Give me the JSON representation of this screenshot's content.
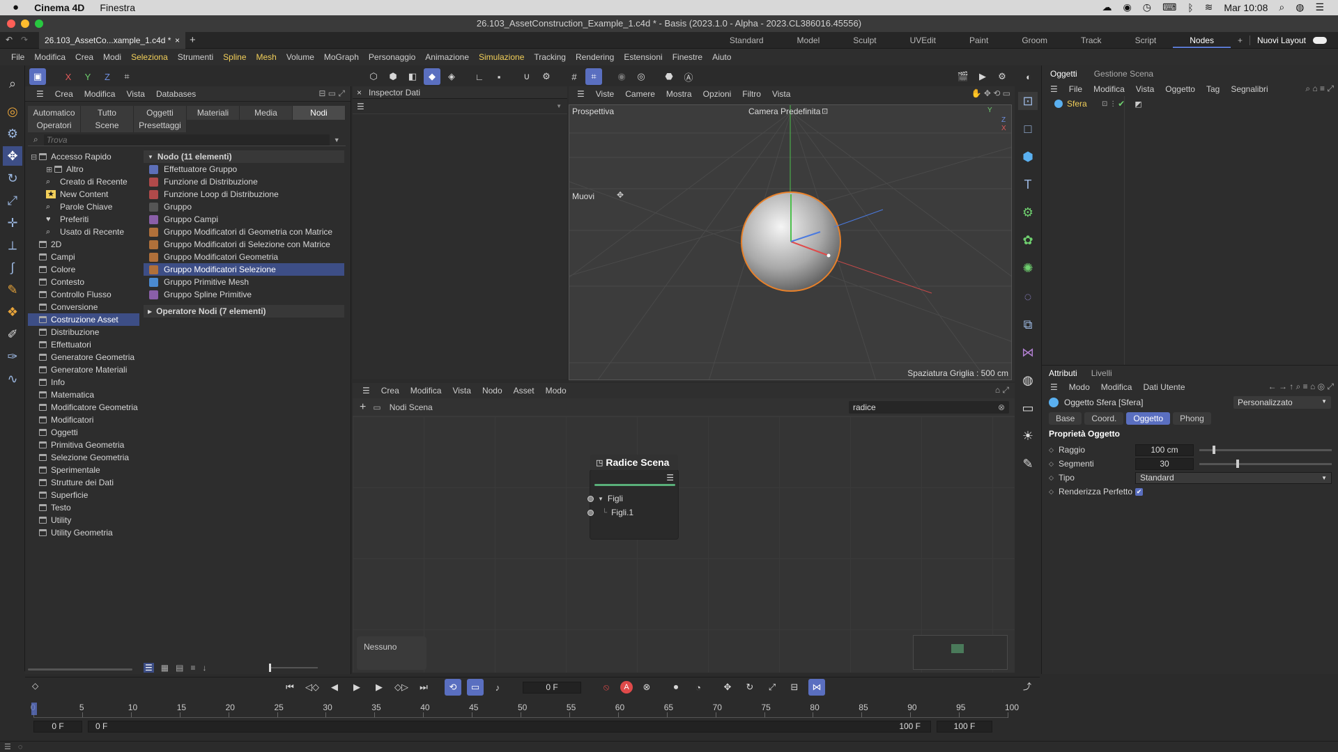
{
  "macbar": {
    "app": "Cinema 4D",
    "menu": "Finestra",
    "datetime": "Mar 10:08"
  },
  "window": {
    "title": "26.103_AssetConstruction_Example_1.c4d * - Basis (2023.1.0 - Alpha - 2023.CL386016.45556)"
  },
  "doc_tab": {
    "label": "26.103_AssetCo...xample_1.c4d *",
    "close": "×",
    "add": "+"
  },
  "layouts": [
    "Standard",
    "Model",
    "Sculpt",
    "UVEdit",
    "Paint",
    "Groom",
    "Track",
    "Script",
    "Nodes"
  ],
  "layout_active": "Nodes",
  "layout_add": "+",
  "layout_new": "Nuovi Layout",
  "menu": {
    "items": [
      "File",
      "Modifica",
      "Crea",
      "Modi",
      "Seleziona",
      "Strumenti",
      "Spline",
      "Mesh",
      "Volume",
      "MoGraph",
      "Personaggio",
      "Animazione",
      "Simulazione",
      "Tracking",
      "Rendering",
      "Estensioni",
      "Finestre",
      "Aiuto"
    ],
    "highlight": [
      "Seleziona",
      "Spline",
      "Mesh",
      "Simulazione"
    ]
  },
  "axis_tools": {
    "x": "X",
    "y": "Y",
    "z": "Z"
  },
  "asset_browser": {
    "menu": [
      "Crea",
      "Modifica",
      "Vista",
      "Databases"
    ],
    "tabs_row1": [
      "Automatico",
      "Tutto",
      "Oggetti",
      "Materiali",
      "Media",
      "Nodi"
    ],
    "tab_active": "Nodi",
    "tabs_row2": [
      "Operatori",
      "Scene",
      "Presettaggi"
    ],
    "search_placeholder": "Trova",
    "tree": [
      {
        "label": "Accesso Rapido",
        "level": 0,
        "expand": "⊟"
      },
      {
        "label": "Altro",
        "level": 1,
        "expand": "⊞"
      },
      {
        "label": "Creato di Recente",
        "level": 1,
        "icon": "search-icon"
      },
      {
        "label": "New Content",
        "level": 1,
        "icon": "new-icon"
      },
      {
        "label": "Parole Chiave",
        "level": 1,
        "icon": "search-icon"
      },
      {
        "label": "Preferiti",
        "level": 1,
        "icon": "heart-icon"
      },
      {
        "label": "Usato di Recente",
        "level": 1,
        "icon": "search-icon"
      },
      {
        "label": "2D",
        "level": 0
      },
      {
        "label": "Campi",
        "level": 0
      },
      {
        "label": "Colore",
        "level": 0
      },
      {
        "label": "Contesto",
        "level": 0
      },
      {
        "label": "Controllo Flusso",
        "level": 0
      },
      {
        "label": "Conversione",
        "level": 0
      },
      {
        "label": "Costruzione Asset",
        "level": 0,
        "selected": true
      },
      {
        "label": "Distribuzione",
        "level": 0
      },
      {
        "label": "Effettuatori",
        "level": 0
      },
      {
        "label": "Generatore Geometria",
        "level": 0
      },
      {
        "label": "Generatore Materiali",
        "level": 0
      },
      {
        "label": "Info",
        "level": 0
      },
      {
        "label": "Matematica",
        "level": 0
      },
      {
        "label": "Modificatore Geometria",
        "level": 0
      },
      {
        "label": "Modificatori",
        "level": 0
      },
      {
        "label": "Oggetti",
        "level": 0
      },
      {
        "label": "Primitiva Geometria",
        "level": 0
      },
      {
        "label": "Selezione Geometria",
        "level": 0
      },
      {
        "label": "Sperimentale",
        "level": 0
      },
      {
        "label": "Strutture dei Dati",
        "level": 0
      },
      {
        "label": "Superficie",
        "level": 0
      },
      {
        "label": "Testo",
        "level": 0
      },
      {
        "label": "Utility",
        "level": 0
      },
      {
        "label": "Utility Geometria",
        "level": 0
      }
    ],
    "group1": "Nodo (11 elementi)",
    "nodes": [
      {
        "label": "Effettuatore Gruppo",
        "color": "#5d6fb8"
      },
      {
        "label": "Funzione di Distribuzione",
        "color": "#b04a4a"
      },
      {
        "label": "Funzione Loop di Distribuzione",
        "color": "#b04a4a"
      },
      {
        "label": "Gruppo",
        "color": "#555555"
      },
      {
        "label": "Gruppo Campi",
        "color": "#8a5fa8"
      },
      {
        "label": "Gruppo Modificatori di Geometria con Matrice",
        "color": "#b0703a"
      },
      {
        "label": "Gruppo Modificatori di Selezione con Matrice",
        "color": "#b0703a"
      },
      {
        "label": "Gruppo Modificatori Geometria",
        "color": "#b0703a"
      },
      {
        "label": "Gruppo Modificatori Selezione",
        "color": "#b0703a",
        "selected": true
      },
      {
        "label": "Gruppo Primitive Mesh",
        "color": "#4a8ad0"
      },
      {
        "label": "Gruppo Spline Primitive",
        "color": "#8a5fa8"
      }
    ],
    "group2": "Operatore Nodi (7 elementi)"
  },
  "inspector": {
    "title": "Inspector Dati"
  },
  "viewport": {
    "menu": [
      "Viste",
      "Camere",
      "Mostra",
      "Opzioni",
      "Filtro",
      "Vista"
    ],
    "projection": "Prospettiva",
    "camera": "Camera Predefinita",
    "tool": "Muovi",
    "grid": "Spaziatura Griglia : 500 cm",
    "axes": {
      "x": "X",
      "y": "Y",
      "z": "Z"
    }
  },
  "node_editor": {
    "menu": [
      "Crea",
      "Modifica",
      "Vista",
      "Nodo",
      "Asset",
      "Modo"
    ],
    "breadcrumb": "Nodi Scena",
    "search_value": "radice",
    "node_title": "Radice Scena",
    "ports": [
      "Figli",
      "Figli.1"
    ],
    "selection_info": "Nessuno"
  },
  "objects": {
    "tabs": [
      "Oggetti",
      "Gestione Scena"
    ],
    "menu": [
      "File",
      "Modifica",
      "Vista",
      "Oggetto",
      "Tag",
      "Segnalibri"
    ],
    "item": "Sfera"
  },
  "attributes": {
    "tabs": [
      "Attributi",
      "Livelli"
    ],
    "menu": [
      "Modo",
      "Modifica",
      "Dati Utente"
    ],
    "object_title": "Oggetto Sfera [Sfera]",
    "preset": "Personalizzato",
    "subtabs": [
      "Base",
      "Coord.",
      "Oggetto",
      "Phong"
    ],
    "subtab_active": "Oggetto",
    "section": "Proprietà Oggetto",
    "props": [
      {
        "label": "Raggio",
        "value": "100 cm",
        "slider": 0.1
      },
      {
        "label": "Segmenti",
        "value": "30",
        "slider": 0.28
      },
      {
        "label": "Tipo",
        "value": "Standard"
      },
      {
        "label": "Renderizza Perfetto",
        "check": true
      }
    ]
  },
  "timeline": {
    "frame": "0 F",
    "ticks": [
      "0",
      "5",
      "10",
      "15",
      "20",
      "25",
      "30",
      "35",
      "40",
      "45",
      "50",
      "55",
      "60",
      "65",
      "70",
      "75",
      "80",
      "85",
      "90",
      "95",
      "100"
    ],
    "start": "0 F",
    "start2": "0 F",
    "end": "100 F",
    "end2": "100 F",
    "record_a": "A"
  }
}
